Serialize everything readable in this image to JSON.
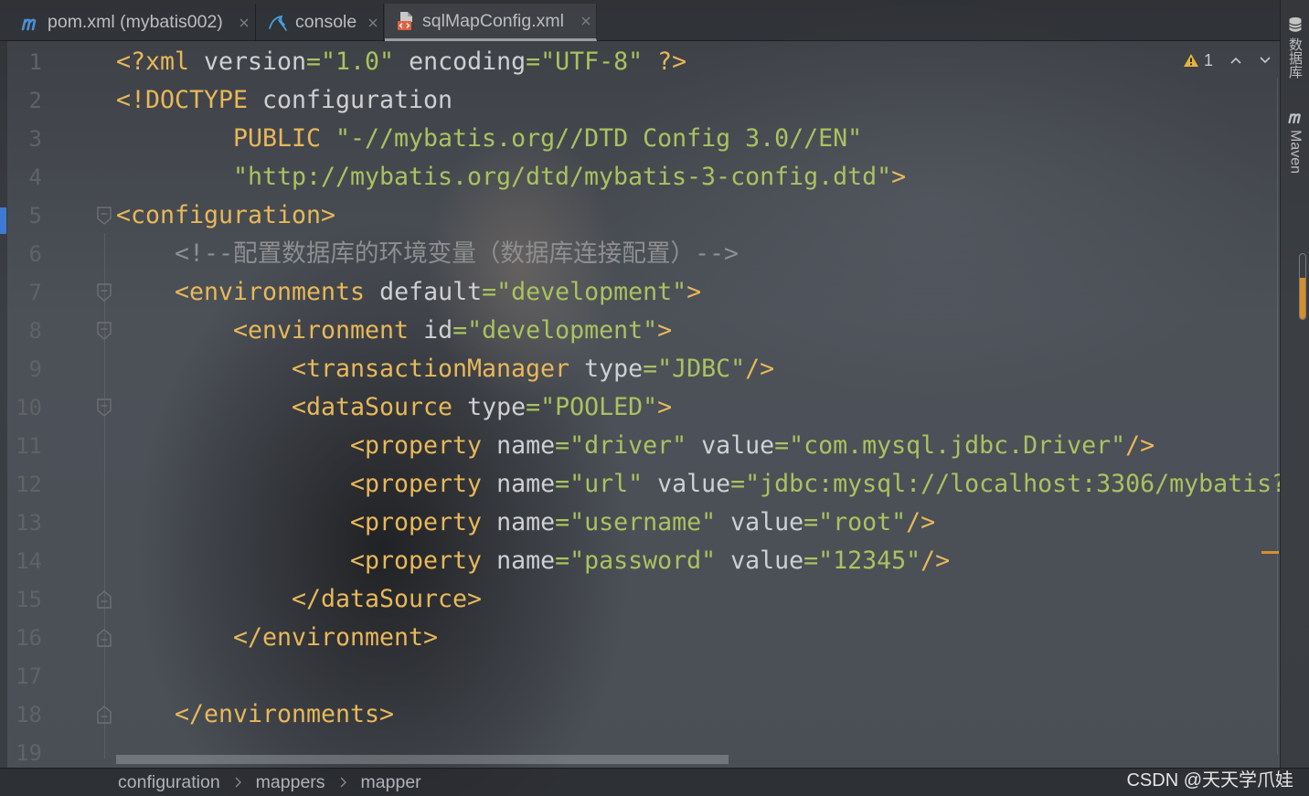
{
  "colors": {
    "tag": "#e8b859",
    "attr": "#cfd0d1",
    "value": "#a9c35f",
    "comment": "#8e8f90",
    "plain": "#cfd0d1",
    "line_number": "#5f6366",
    "warning": "#e8b33b",
    "change_marker": "#3f7ad1",
    "stripe_marker": "#d68f2a",
    "active_tab_underline": "#9a9da1"
  },
  "tabs": [
    {
      "label": "pom.xml (mybatis002)",
      "icon": "maven-icon"
    },
    {
      "label": "console",
      "icon": "database-console-icon"
    },
    {
      "label": "sqlMapConfig.xml",
      "icon": "xml-file-icon",
      "active": true
    }
  ],
  "inspections": {
    "warning_count": "1"
  },
  "editor": {
    "lines": [
      {
        "number": "1",
        "tokens": [
          {
            "t": "tag",
            "v": "<?xml"
          },
          {
            "t": "text",
            "v": " "
          },
          {
            "t": "attr",
            "v": "version"
          },
          {
            "t": "value",
            "v": "=\"1.0\""
          },
          {
            "t": "text",
            "v": " "
          },
          {
            "t": "attr",
            "v": "encoding"
          },
          {
            "t": "value",
            "v": "=\"UTF-8\""
          },
          {
            "t": "text",
            "v": " "
          },
          {
            "t": "tag",
            "v": "?>"
          }
        ]
      },
      {
        "number": "2",
        "tokens": [
          {
            "t": "tag",
            "v": "<!DOCTYPE"
          },
          {
            "t": "text",
            "v": " "
          },
          {
            "t": "attr",
            "v": "configuration"
          }
        ]
      },
      {
        "number": "3",
        "tokens": [
          {
            "t": "text",
            "v": "        "
          },
          {
            "t": "tag",
            "v": "PUBLIC"
          },
          {
            "t": "text",
            "v": " "
          },
          {
            "t": "value",
            "v": "\"-//mybatis.org//DTD Config 3.0//EN\""
          }
        ]
      },
      {
        "number": "4",
        "tokens": [
          {
            "t": "text",
            "v": "        "
          },
          {
            "t": "value",
            "v": "\"http://mybatis.org/dtd/mybatis-3-config.dtd\""
          },
          {
            "t": "tag",
            "v": ">"
          }
        ]
      },
      {
        "number": "5",
        "fold": "start",
        "marker": "change",
        "tokens": [
          {
            "t": "tag",
            "v": "<configuration>"
          }
        ]
      },
      {
        "number": "6",
        "tokens": [
          {
            "t": "text",
            "v": "    "
          },
          {
            "t": "comment",
            "v": "<!--配置数据库的环境变量（数据库连接配置）-->"
          }
        ]
      },
      {
        "number": "7",
        "fold": "start",
        "tokens": [
          {
            "t": "text",
            "v": "    "
          },
          {
            "t": "tag",
            "v": "<environments"
          },
          {
            "t": "text",
            "v": " "
          },
          {
            "t": "attr",
            "v": "default"
          },
          {
            "t": "value",
            "v": "=\"development\""
          },
          {
            "t": "tag",
            "v": ">"
          }
        ]
      },
      {
        "number": "8",
        "fold": "start",
        "tokens": [
          {
            "t": "text",
            "v": "        "
          },
          {
            "t": "tag",
            "v": "<environment"
          },
          {
            "t": "text",
            "v": " "
          },
          {
            "t": "attr",
            "v": "id"
          },
          {
            "t": "value",
            "v": "=\"development\""
          },
          {
            "t": "tag",
            "v": ">"
          }
        ]
      },
      {
        "number": "9",
        "tokens": [
          {
            "t": "text",
            "v": "            "
          },
          {
            "t": "tag",
            "v": "<transactionManager"
          },
          {
            "t": "text",
            "v": " "
          },
          {
            "t": "attr",
            "v": "type"
          },
          {
            "t": "value",
            "v": "=\"JDBC\""
          },
          {
            "t": "tag",
            "v": "/>"
          }
        ]
      },
      {
        "number": "10",
        "fold": "start",
        "tokens": [
          {
            "t": "text",
            "v": "            "
          },
          {
            "t": "tag",
            "v": "<dataSource"
          },
          {
            "t": "text",
            "v": " "
          },
          {
            "t": "attr",
            "v": "type"
          },
          {
            "t": "value",
            "v": "=\"POOLED\""
          },
          {
            "t": "tag",
            "v": ">"
          }
        ]
      },
      {
        "number": "11",
        "tokens": [
          {
            "t": "text",
            "v": "                "
          },
          {
            "t": "tag",
            "v": "<property"
          },
          {
            "t": "text",
            "v": " "
          },
          {
            "t": "attr",
            "v": "name"
          },
          {
            "t": "value",
            "v": "=\"driver\""
          },
          {
            "t": "text",
            "v": " "
          },
          {
            "t": "attr",
            "v": "value"
          },
          {
            "t": "value",
            "v": "=\"com.mysql.jdbc.Driver\""
          },
          {
            "t": "tag",
            "v": "/>"
          }
        ]
      },
      {
        "number": "12",
        "tokens": [
          {
            "t": "text",
            "v": "                "
          },
          {
            "t": "tag",
            "v": "<property"
          },
          {
            "t": "text",
            "v": " "
          },
          {
            "t": "attr",
            "v": "name"
          },
          {
            "t": "value",
            "v": "=\"url\""
          },
          {
            "t": "text",
            "v": " "
          },
          {
            "t": "attr",
            "v": "value"
          },
          {
            "t": "value",
            "v": "=\"jdbc:mysql://localhost:3306/mybatis?"
          }
        ]
      },
      {
        "number": "13",
        "tokens": [
          {
            "t": "text",
            "v": "                "
          },
          {
            "t": "tag",
            "v": "<property"
          },
          {
            "t": "text",
            "v": " "
          },
          {
            "t": "attr",
            "v": "name"
          },
          {
            "t": "value",
            "v": "=\"username\""
          },
          {
            "t": "text",
            "v": " "
          },
          {
            "t": "attr",
            "v": "value"
          },
          {
            "t": "value",
            "v": "=\"root\""
          },
          {
            "t": "tag",
            "v": "/>"
          }
        ]
      },
      {
        "number": "14",
        "tokens": [
          {
            "t": "text",
            "v": "                "
          },
          {
            "t": "tag",
            "v": "<property"
          },
          {
            "t": "text",
            "v": " "
          },
          {
            "t": "attr",
            "v": "name"
          },
          {
            "t": "value",
            "v": "=\"password\""
          },
          {
            "t": "text",
            "v": " "
          },
          {
            "t": "attr",
            "v": "value"
          },
          {
            "t": "value",
            "v": "=\"12345\""
          },
          {
            "t": "tag",
            "v": "/>"
          }
        ]
      },
      {
        "number": "15",
        "fold": "end",
        "tokens": [
          {
            "t": "text",
            "v": "            "
          },
          {
            "t": "tag",
            "v": "</dataSource>"
          }
        ]
      },
      {
        "number": "16",
        "fold": "end",
        "tokens": [
          {
            "t": "text",
            "v": "        "
          },
          {
            "t": "tag",
            "v": "</environment>"
          }
        ]
      },
      {
        "number": "17",
        "tokens": []
      },
      {
        "number": "18",
        "fold": "end",
        "tokens": [
          {
            "t": "text",
            "v": "    "
          },
          {
            "t": "tag",
            "v": "</environments>"
          }
        ]
      },
      {
        "number": "19",
        "tokens": []
      }
    ]
  },
  "breadcrumb": {
    "items": [
      "configuration",
      "mappers",
      "mapper"
    ]
  },
  "tool_windows": {
    "database_label": "数据库",
    "maven_label": "Maven"
  },
  "watermark": "CSDN @天天学爪娃"
}
